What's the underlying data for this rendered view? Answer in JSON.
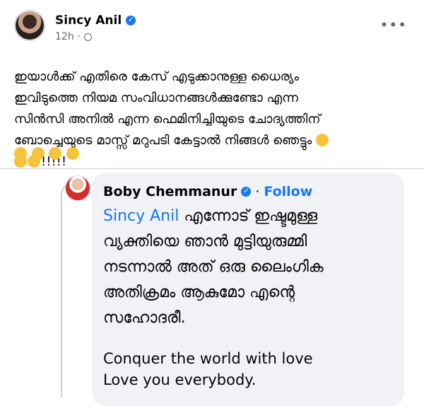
{
  "post": {
    "author": "Sincy Anil",
    "time": "12h",
    "more": "•••",
    "text_lines": [
      "ഇയാൾക്ക് എതിരെ കേസ് എടുക്കാനുള്ള ധൈര്യം",
      "ഇവിടുത്തെ നിയമ സംവിധാനങ്ങൾക്കുണ്ടോ എന്ന",
      "സിൻസി അനിൽ എന്ന ഫെമിനിച്ചിയുടെ ചോദ്യത്തിന്",
      "ബോച്ചെയുടെ മാസ്സ് മറുപടി  കേട്ടാൽ നിങ്ങൾ ഞെട്ടും",
      "!!!!!"
    ]
  },
  "embed": {
    "author": "Boby Chemmanur",
    "separator": "·",
    "follow": "Follow",
    "mention": "Sincy Anil",
    "line1_rest": " എന്നോട് ഇഷ്ടമുള്ള",
    "lines": [
      "വ്യക്തിയെ ഞാൻ മുട്ടിയുരുമ്മി",
      "നടന്നാൽ അത് ഒരു ലൈംഗിക",
      "അതിക്രമം ആകുമോ എന്റെ",
      "സഹോദരീ."
    ],
    "english": [
      "Conquer the world with love",
      "Love you everybody."
    ]
  },
  "colors": {
    "accent": "#1877f2",
    "embed_bg": "#f0f2f5",
    "meta": "#65676b"
  },
  "icons": [
    "verified-badge-icon",
    "globe-icon",
    "more-options-icon",
    "emoji-icon"
  ]
}
